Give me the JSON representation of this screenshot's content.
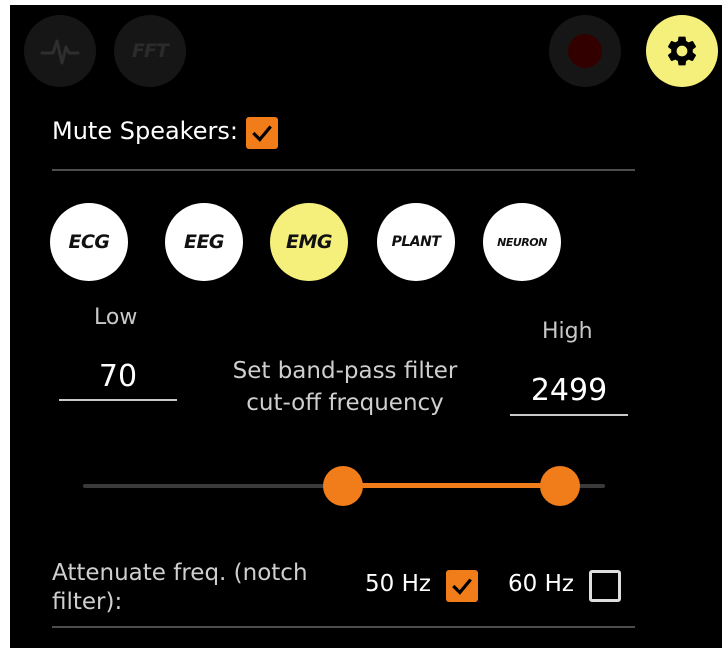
{
  "toolbar": {
    "signal_icon": "heart-signal-icon",
    "fft_label": "FFT",
    "record_icon": "record-icon",
    "settings_icon": "gear-icon"
  },
  "mute": {
    "label": "Mute Speakers:",
    "checked": true
  },
  "presets": [
    {
      "label": "ECG",
      "active": false
    },
    {
      "label": "EEG",
      "active": false
    },
    {
      "label": "EMG",
      "active": true
    },
    {
      "label": "PLANT",
      "active": false
    },
    {
      "label": "NEURON",
      "active": false
    }
  ],
  "filter": {
    "low_label": "Low",
    "high_label": "High",
    "low_value": "70",
    "high_value": "2499",
    "description_line1": "Set band-pass filter",
    "description_line2": "cut-off frequency"
  },
  "notch": {
    "label_line1": "Attenuate freq. (notch",
    "label_line2": "filter):",
    "hz50_label": "50 Hz",
    "hz50_checked": true,
    "hz60_label": "60 Hz",
    "hz60_checked": false
  },
  "colors": {
    "accent": "#f07d1a",
    "highlight": "#f5f07c",
    "background": "#000000"
  }
}
